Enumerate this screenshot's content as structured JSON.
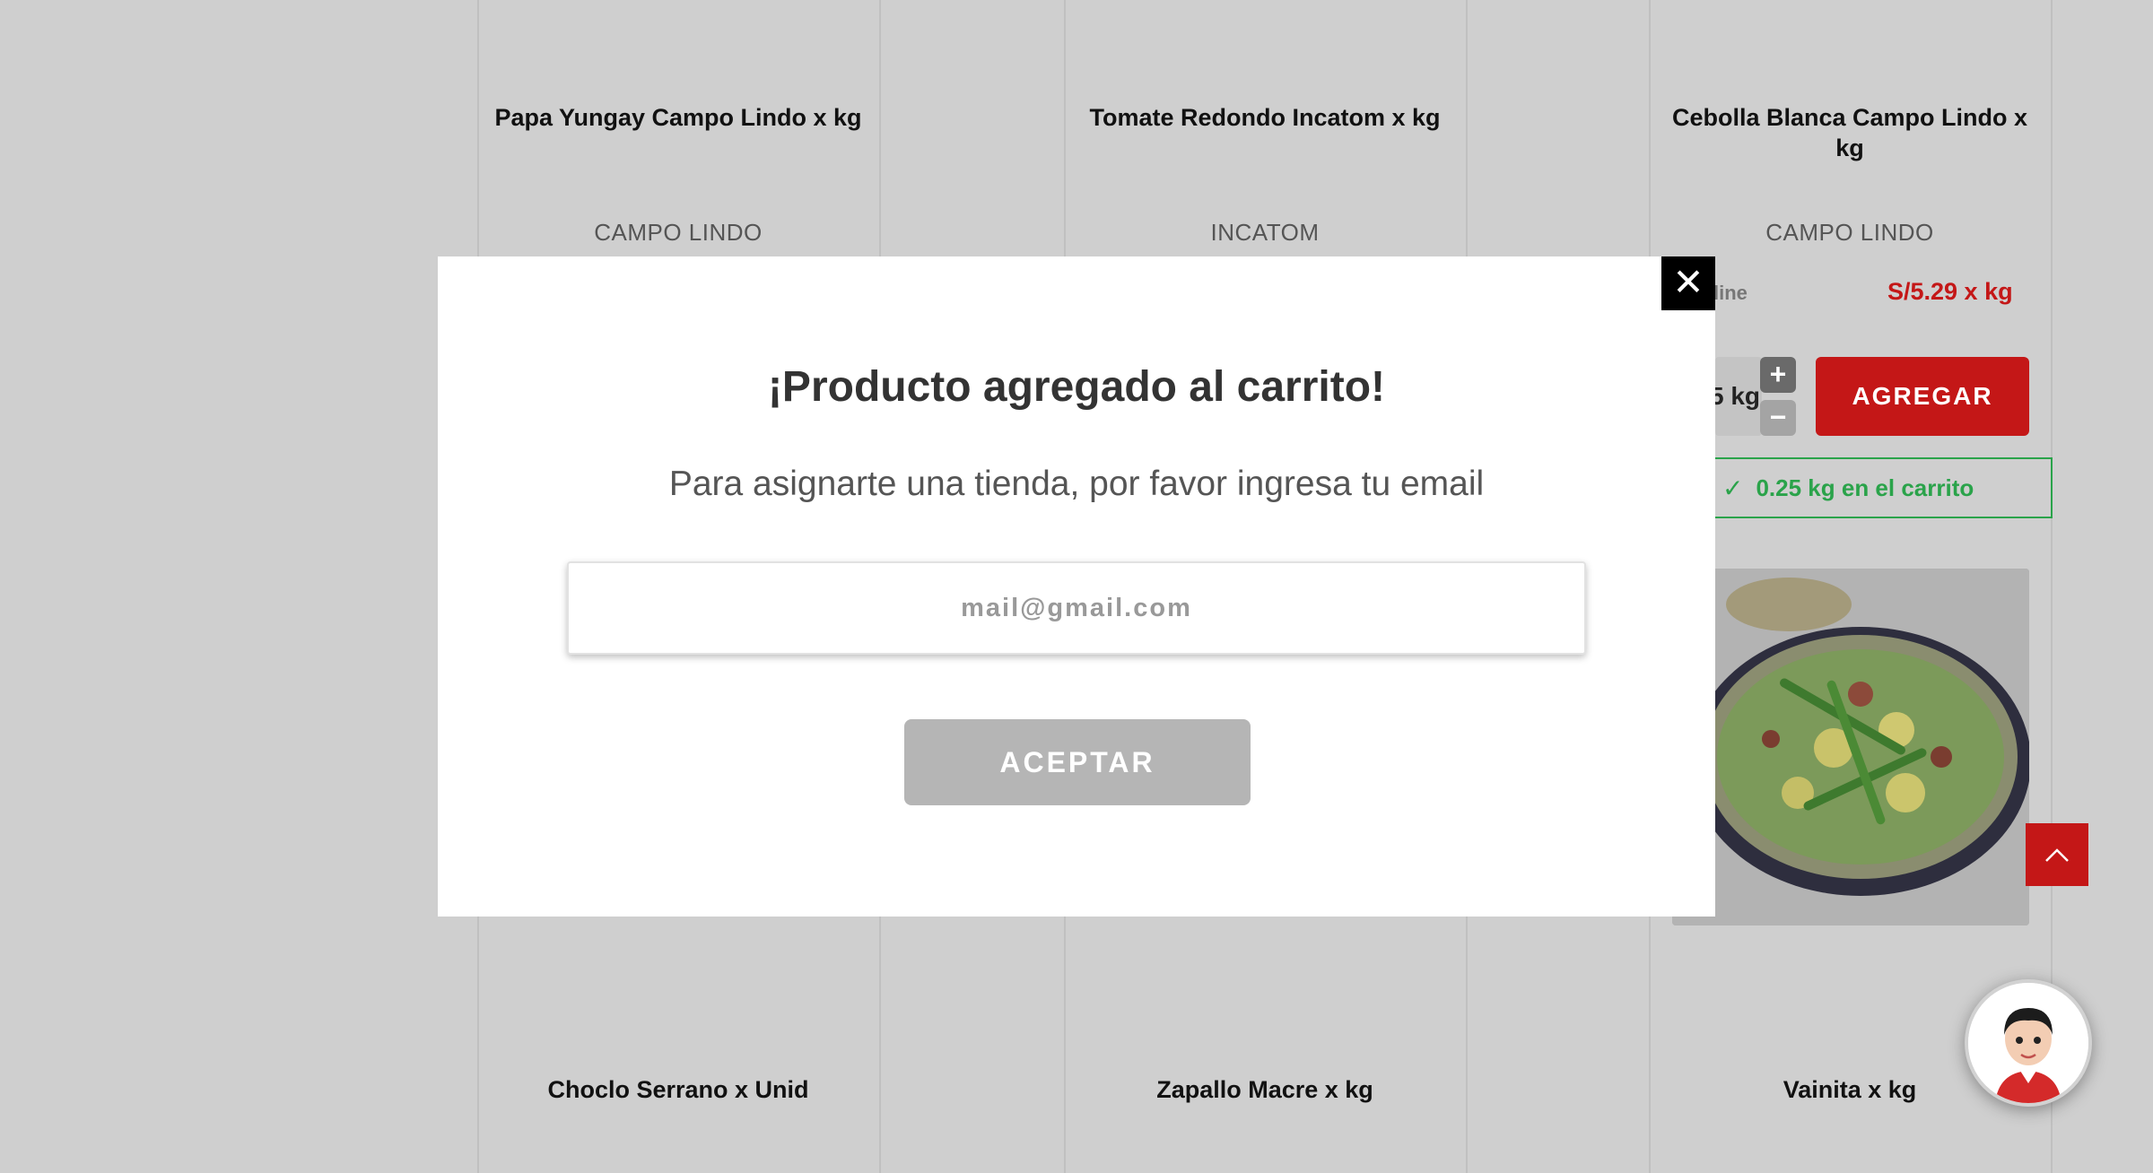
{
  "products_top": [
    {
      "name": "Papa Yungay Campo Lindo x kg",
      "brand": "CAMPO LINDO"
    },
    {
      "name": "Tomate Redondo Incatom x kg",
      "brand": "INCATOM"
    },
    {
      "name": "Cebolla Blanca Campo Lindo x kg",
      "brand": "CAMPO LINDO"
    }
  ],
  "products_bottom": [
    {
      "name": "Choclo Serrano x Unid"
    },
    {
      "name": "Zapallo Macre x kg"
    },
    {
      "name": "Vainita x kg"
    }
  ],
  "right_card": {
    "online_fragment": "line",
    "price": "S/5.29 x kg",
    "qty_fragment": "5 kg",
    "plus": "+",
    "minus": "−",
    "add_label": "AGREGAR",
    "cart_note": "0.25 kg en el carrito",
    "check": "✓"
  },
  "modal": {
    "close": "✕",
    "title": "¡Producto agregado al carrito!",
    "subtitle": "Para asignarte una tienda, por favor ingresa tu email",
    "email_placeholder": "mail@gmail.com",
    "email_value": "",
    "accept_label": "ACEPTAR"
  },
  "colors": {
    "accent_red": "#c41717",
    "success_green": "#2aa34a",
    "overlay_gray": "#cfcfcf"
  },
  "icons": {
    "scroll_top": "chevron-up-icon",
    "assistant": "avatar-assistant-icon",
    "close": "close-icon",
    "check": "check-icon"
  }
}
